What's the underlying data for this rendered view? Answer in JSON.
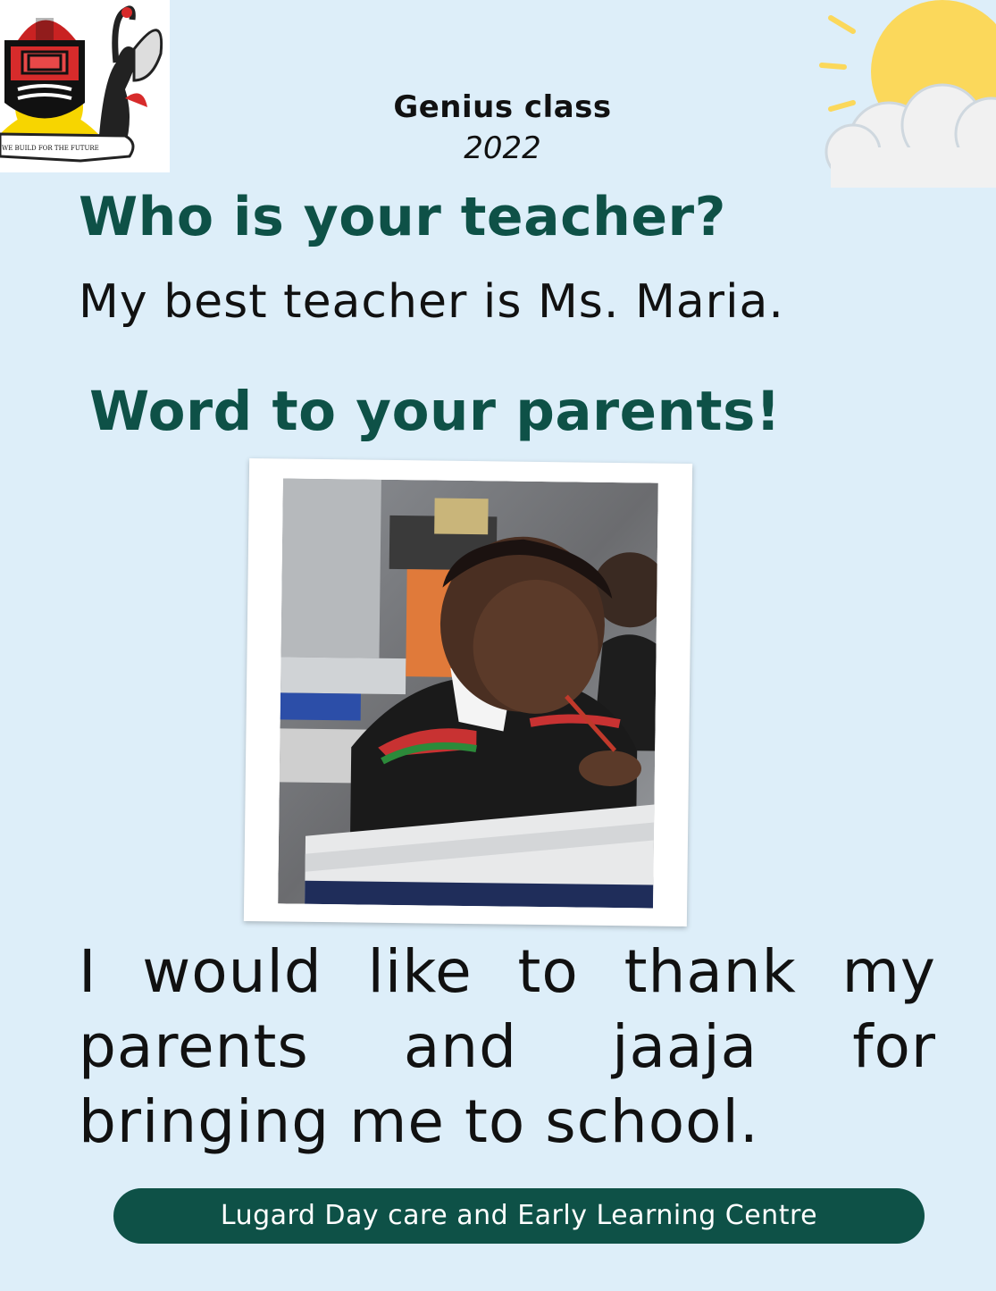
{
  "logo": {
    "motto": "WE BUILD FOR THE FUTURE",
    "icon": "university-crest-logo"
  },
  "decoration": {
    "icon": "sun-cloud-icon"
  },
  "header": {
    "title": "Genius class",
    "year": "2022"
  },
  "teacher": {
    "question": "Who is your teacher?",
    "answer": "My best teacher is Ms. Maria."
  },
  "parents": {
    "heading": "Word to your parents!",
    "message": "I would like to thank my parents and jaaja for bringing me to school."
  },
  "photo": {
    "icon": "student-writing-photo"
  },
  "footer": {
    "label": "Lugard Day care and Early Learning Centre"
  },
  "colors": {
    "background": "#ddeef9",
    "accent": "#0e5147"
  }
}
